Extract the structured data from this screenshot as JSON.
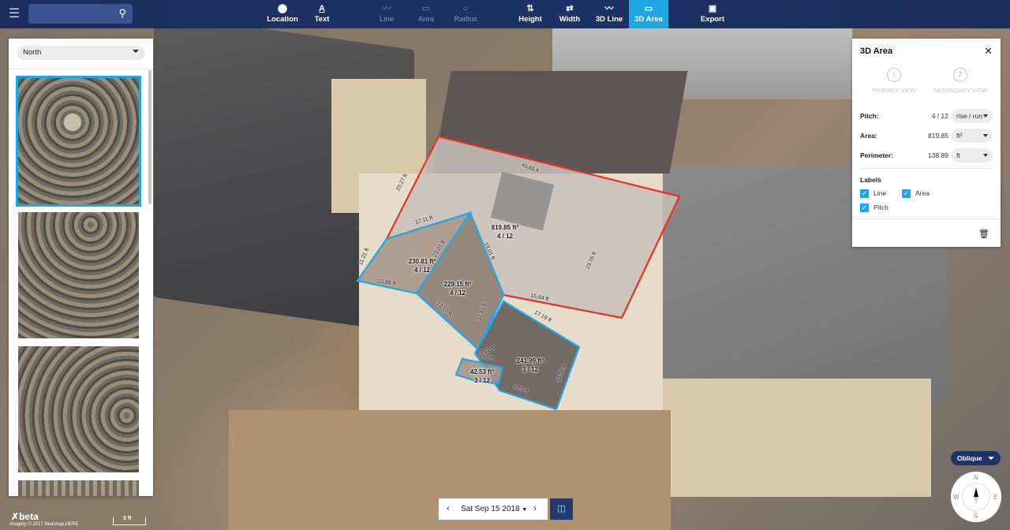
{
  "colors": {
    "accent": "#1fa8e6",
    "navbar": "#1d3366",
    "primary_outline": "#e8302a",
    "secondary_outline": "#1fa8e6"
  },
  "header": {
    "menu_icon": "hamburger-menu-icon",
    "search": {
      "placeholder": "",
      "icon": "search-icon"
    },
    "tools": [
      {
        "label": "Location",
        "icon": "location-pin-icon",
        "state": "enabled"
      },
      {
        "label": "Text",
        "icon": "text-icon",
        "state": "enabled"
      },
      {
        "label": "Line",
        "icon": "line-icon",
        "state": "disabled"
      },
      {
        "label": "Area",
        "icon": "area-icon",
        "state": "disabled"
      },
      {
        "label": "Radius",
        "icon": "radius-icon",
        "state": "disabled"
      },
      {
        "label": "Height",
        "icon": "height-icon",
        "state": "enabled"
      },
      {
        "label": "Width",
        "icon": "width-icon",
        "state": "enabled"
      },
      {
        "label": "3D Line",
        "icon": "3d-line-icon",
        "state": "enabled"
      },
      {
        "label": "3D Area",
        "icon": "3d-area-icon",
        "state": "active"
      },
      {
        "label": "Export",
        "icon": "export-icon",
        "state": "enabled"
      }
    ]
  },
  "left_panel": {
    "direction": "North",
    "thumbnails": [
      {
        "name": "thumbnail-1",
        "selected": true
      },
      {
        "name": "thumbnail-2",
        "selected": false
      },
      {
        "name": "thumbnail-3",
        "selected": false
      },
      {
        "name": "thumbnail-4",
        "selected": false
      }
    ]
  },
  "right_panel": {
    "title": "3D Area",
    "steps": [
      {
        "number": "1",
        "label": "PRIMARY VIEW"
      },
      {
        "number": "2",
        "label": "SECONDARY VIEW"
      }
    ],
    "pitch": {
      "label": "Pitch:",
      "value": "4 / 12",
      "unit": "rise / run"
    },
    "area": {
      "label": "Area:",
      "value": "819.85",
      "unit": "ft²"
    },
    "perimeter": {
      "label": "Perimeter:",
      "value": "138.89",
      "unit": "ft"
    },
    "labels_heading": "Labels",
    "checkboxes": [
      {
        "label": "Line",
        "checked": true
      },
      {
        "label": "Area",
        "checked": true
      },
      {
        "label": "Pitch",
        "checked": true
      }
    ]
  },
  "map": {
    "polygons": [
      {
        "area": "819.85 ft²",
        "pitch": "4 / 12",
        "color": "red"
      },
      {
        "area": "230.81 ft²",
        "pitch": "4 / 12",
        "color": "blue"
      },
      {
        "area": "229.15 ft²",
        "pitch": "4 / 12",
        "color": "blue"
      },
      {
        "area": "241.99 ft²",
        "pitch": "3 / 12",
        "color": "blue"
      },
      {
        "area": "42.53 ft²",
        "pitch": "3 / 12",
        "color": "blue"
      }
    ],
    "edge_labels": [
      "40.69 ft",
      "23.27 ft",
      "17.11 ft",
      "18.01 ft",
      "23.76 ft",
      "15.84 ft",
      "11.21 ft",
      "13.88 ft",
      "23.01 ft",
      "13.19 ft",
      "11.41 ft",
      "17.19 ft",
      "7.91 ft",
      "9.88 ft",
      "9.53 ft",
      "18.08 ft"
    ]
  },
  "date_bar": {
    "date": "Sat Sep 15 2018",
    "prev": "‹",
    "next": "›"
  },
  "view_mode": "Oblique",
  "compass": {
    "n": "N",
    "s": "S",
    "e": "E",
    "w": "W"
  },
  "footer": {
    "beta": "beta",
    "credit": "Imagery © 2017 Nearmap,HERE",
    "scale": "5 ft"
  }
}
